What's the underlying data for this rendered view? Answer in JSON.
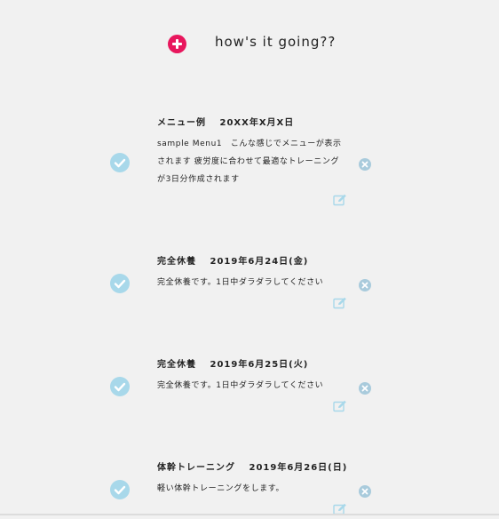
{
  "header": {
    "greeting": "how's it going??",
    "add_icon": "plus-circle-icon",
    "accent_color": "#e8175d"
  },
  "colors": {
    "check": "#a8d8ea",
    "delete": "#a9cbdc",
    "edit": "#a8d8ea"
  },
  "menus": [
    {
      "title": "メニュー例　 20XX年X月X日",
      "lines": [
        "sample Menu1　こんな感じでメニューが表示",
        "されます 疲労度に合わせて最適なトレーニング",
        "が3日分作成されます"
      ]
    },
    {
      "title": "完全休養　 2019年6月24日(金)",
      "lines": [
        "完全休養です。1日中ダラダラしてください"
      ]
    },
    {
      "title": "完全休養　 2019年6月25日(火)",
      "lines": [
        "完全休養です。1日中ダラダラしてください"
      ]
    },
    {
      "title": "体幹トレーニング　 2019年6月26日(日)",
      "lines": [
        "軽い体幹トレーニングをします。"
      ]
    }
  ]
}
